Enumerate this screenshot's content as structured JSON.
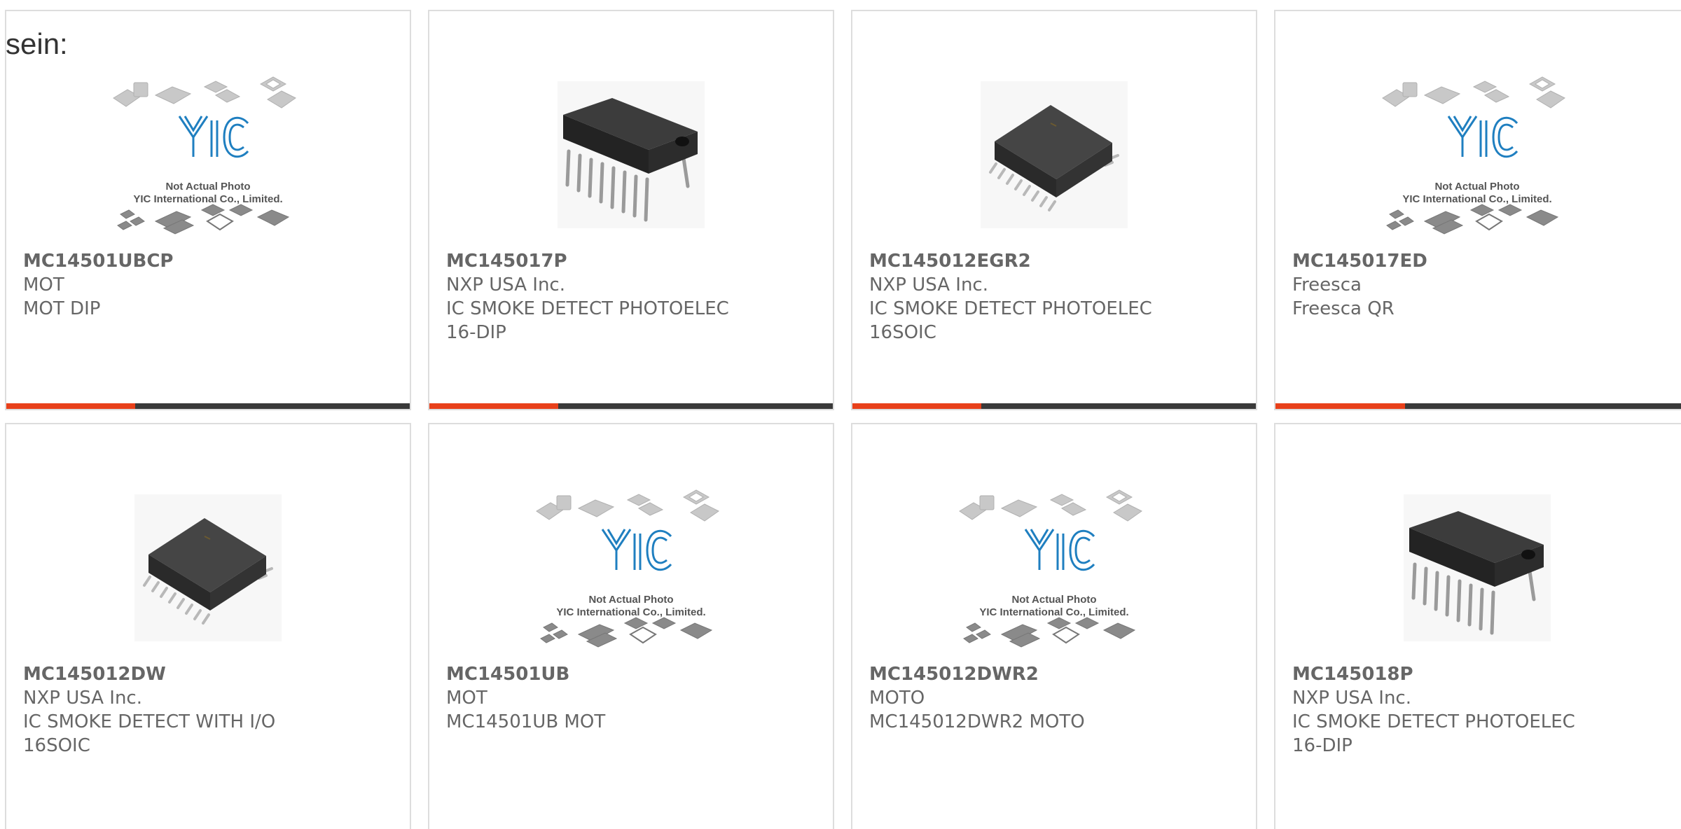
{
  "intro_text": "sein:",
  "colors": {
    "accent": "#e8401a",
    "bar_dark": "#3a3a3a",
    "yic_blue": "#1f7fc0"
  },
  "placeholder": {
    "brand": "YIC",
    "caption_line1": "Not Actual Photo",
    "caption_line2": "YIC International Co., Limited."
  },
  "products": [
    {
      "part_number": "MC14501UBCP",
      "manufacturer": "MOT",
      "description": "MOT DIP",
      "package": "",
      "image": "yic-placeholder"
    },
    {
      "part_number": "MC145017P",
      "manufacturer": "NXP USA Inc.",
      "description": "IC SMOKE DETECT PHOTOELEC",
      "package": "16-DIP",
      "image": "dip-chip"
    },
    {
      "part_number": "MC145012EGR2",
      "manufacturer": "NXP USA Inc.",
      "description": "IC SMOKE DETECT PHOTOELEC",
      "package": "16SOIC",
      "image": "soic-chip"
    },
    {
      "part_number": "MC145017ED",
      "manufacturer": "Freesca",
      "description": "Freesca QR",
      "package": "",
      "image": "yic-placeholder"
    },
    {
      "part_number": "MC145012DW",
      "manufacturer": "NXP USA Inc.",
      "description": "IC SMOKE DETECT WITH I/O",
      "package": "16SOIC",
      "image": "soic-chip"
    },
    {
      "part_number": "MC14501UB",
      "manufacturer": "MOT",
      "description": "MC14501UB MOT",
      "package": "",
      "image": "yic-placeholder"
    },
    {
      "part_number": "MC145012DWR2",
      "manufacturer": "MOTO",
      "description": "MC145012DWR2 MOTO",
      "package": "",
      "image": "yic-placeholder"
    },
    {
      "part_number": "MC145018P",
      "manufacturer": "NXP USA Inc.",
      "description": "IC SMOKE DETECT PHOTOELEC",
      "package": "16-DIP",
      "image": "dip-chip"
    }
  ]
}
